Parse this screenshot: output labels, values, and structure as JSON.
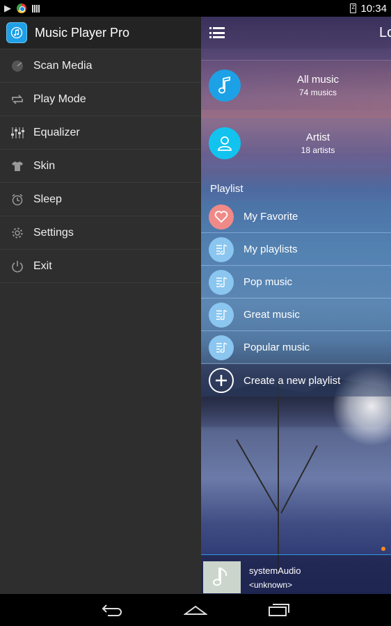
{
  "status_bar": {
    "time": "10:34",
    "icons": [
      "play-icon",
      "chrome-icon",
      "signal-bars-icon",
      "battery-icon"
    ],
    "battery_text": "Z"
  },
  "app": {
    "title": "Music Player Pro",
    "topbar_title": "Lo",
    "accent": "#1da1e6"
  },
  "drawer": {
    "items": [
      {
        "label": "Scan Media",
        "icon": "scan-icon"
      },
      {
        "label": "Play Mode",
        "icon": "repeat-icon"
      },
      {
        "label": "Equalizer",
        "icon": "equalizer-icon"
      },
      {
        "label": "Skin",
        "icon": "shirt-icon"
      },
      {
        "label": "Sleep",
        "icon": "alarm-icon"
      },
      {
        "label": "Settings",
        "icon": "gear-icon"
      },
      {
        "label": "Exit",
        "icon": "power-icon"
      }
    ]
  },
  "library": {
    "all_music": {
      "title": "All music",
      "count": "74 musics"
    },
    "artist": {
      "title": "Artist",
      "count": "18 artists"
    }
  },
  "playlist": {
    "section_label": "Playlist",
    "items": [
      {
        "label": "My Favorite",
        "icon": "heart-icon"
      },
      {
        "label": "My playlists",
        "icon": "playlist-icon"
      },
      {
        "label": "Pop music",
        "icon": "playlist-icon"
      },
      {
        "label": "Great music",
        "icon": "playlist-icon"
      },
      {
        "label": "Popular music",
        "icon": "playlist-icon"
      }
    ],
    "create_label": "Create a new playlist"
  },
  "now_playing": {
    "title": "systemAudio",
    "artist": "<unknown>"
  }
}
